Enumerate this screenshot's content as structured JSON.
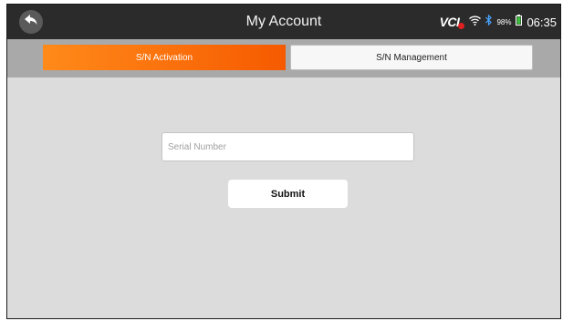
{
  "header": {
    "title": "My Account",
    "back_icon": "back-arrow-icon"
  },
  "status_bar": {
    "vci_label": "VCI",
    "wifi_icon": "wifi-icon",
    "bluetooth_icon": "bluetooth-icon",
    "battery_percent": "98%",
    "battery_icon": "battery-icon",
    "time": "06:35"
  },
  "tabs": [
    {
      "label": "S/N Activation",
      "active": true
    },
    {
      "label": "S/N Management",
      "active": false
    }
  ],
  "form": {
    "serial_placeholder": "Serial Number",
    "serial_value": "",
    "submit_label": "Submit"
  },
  "colors": {
    "accent": "#f65a00",
    "header_bg": "#2b2b2b",
    "tabbar_bg": "#a9a9a9",
    "content_bg": "#dcdcdc"
  }
}
